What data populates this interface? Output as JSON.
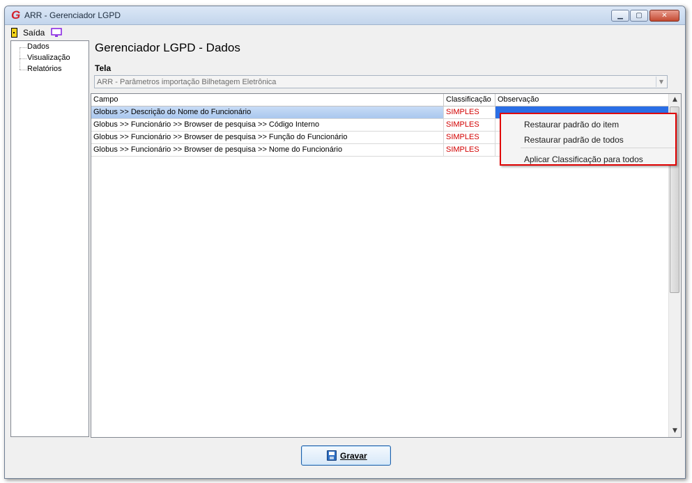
{
  "window": {
    "title": "ARR - Gerenciador LGPD",
    "app_icon_letter": "G",
    "controls": [
      "minimize",
      "maximize",
      "close"
    ]
  },
  "menubar": {
    "items": [
      {
        "label": "Saída",
        "icon": "exit-door-icon"
      },
      {
        "label": "",
        "icon": "monitor-icon"
      }
    ]
  },
  "sidebar": {
    "items": [
      "Dados",
      "Visualização",
      "Relatórios"
    ]
  },
  "main": {
    "title": "Gerenciador LGPD - Dados",
    "tela_label": "Tela",
    "tela_value": "ARR - Parâmetros importação Bilhetagem Eletrônica"
  },
  "grid": {
    "columns": [
      "Campo",
      "Classificação",
      "Observação"
    ],
    "rows": [
      {
        "campo": "Globus >> Descrição do Nome do Funcionário",
        "classificacao": "SIMPLES",
        "observacao": ""
      },
      {
        "campo": "Globus >> Funcionário >> Browser de pesquisa >> Código Interno",
        "classificacao": "SIMPLES",
        "observacao": ""
      },
      {
        "campo": "Globus >> Funcionário >> Browser de pesquisa >> Função do Funcionário",
        "classificacao": "SIMPLES",
        "observacao": ""
      },
      {
        "campo": "Globus >> Funcionário >> Browser de pesquisa >> Nome do Funcionário",
        "classificacao": "SIMPLES",
        "observacao": ""
      }
    ],
    "selected_row_index": 0
  },
  "context_menu": {
    "items": [
      "Restaurar padrão do item",
      "Restaurar padrão de todos",
      "Aplicar Classificação para todos"
    ]
  },
  "footer": {
    "save_label": "Gravar"
  },
  "colors": {
    "classification_text": "#d20000",
    "selection_blue": "#2a6ee6",
    "highlight_border": "#e00000"
  }
}
